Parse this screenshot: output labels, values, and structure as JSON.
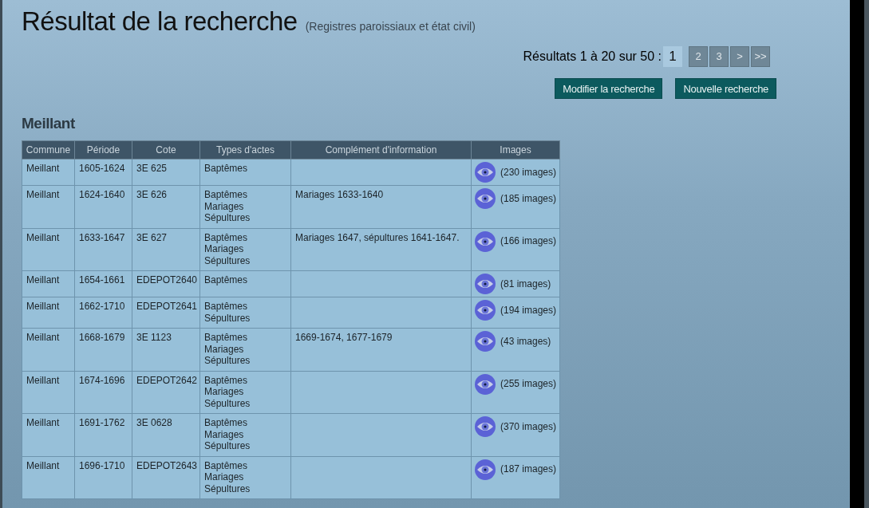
{
  "title": "Résultat de la recherche",
  "subtitle": "(Registres paroissiaux et état civil)",
  "pagination": {
    "summary": "Résultats 1 à 20 sur 50 :",
    "pages": [
      {
        "label": "1",
        "selected": true
      },
      {
        "label": "2",
        "selected": false
      },
      {
        "label": "3",
        "selected": false
      },
      {
        "label": ">",
        "selected": false
      },
      {
        "label": ">>",
        "selected": false
      }
    ]
  },
  "buttons": [
    "Modifier la recherche",
    "Nouvelle recherche"
  ],
  "section_title": "Meillant",
  "table": {
    "columns": [
      "Commune",
      "Période",
      "Cote",
      "Types d'actes",
      "Complément d'information",
      "Images"
    ],
    "rows": [
      {
        "commune": "Meillant",
        "periode": "1605-1624",
        "cote": "3E 625",
        "types": [
          "Baptêmes"
        ],
        "complement": "",
        "images": "(230 images)"
      },
      {
        "commune": "Meillant",
        "periode": "1624-1640",
        "cote": "3E 626",
        "types": [
          "Baptêmes",
          "Mariages",
          "Sépultures"
        ],
        "complement": "Mariages 1633-1640",
        "images": "(185 images)"
      },
      {
        "commune": "Meillant",
        "periode": "1633-1647",
        "cote": "3E 627",
        "types": [
          "Baptêmes",
          "Mariages",
          "Sépultures"
        ],
        "complement": "Mariages 1647, sépultures 1641-1647.",
        "images": "(166 images)"
      },
      {
        "commune": "Meillant",
        "periode": "1654-1661",
        "cote": "EDEPOT2640",
        "types": [
          "Baptêmes"
        ],
        "complement": "",
        "images": "(81 images)"
      },
      {
        "commune": "Meillant",
        "periode": "1662-1710",
        "cote": "EDEPOT2641",
        "types": [
          "Baptêmes",
          "Sépultures"
        ],
        "complement": "",
        "images": "(194 images)"
      },
      {
        "commune": "Meillant",
        "periode": "1668-1679",
        "cote": "3E 1123",
        "types": [
          "Baptêmes",
          "Mariages",
          "Sépultures"
        ],
        "complement": "1669-1674, 1677-1679",
        "images": "(43 images)"
      },
      {
        "commune": "Meillant",
        "periode": "1674-1696",
        "cote": "EDEPOT2642",
        "types": [
          "Baptêmes",
          "Mariages",
          "Sépultures"
        ],
        "complement": "",
        "images": "(255 images)"
      },
      {
        "commune": "Meillant",
        "periode": "1691-1762",
        "cote": "3E 0628",
        "types": [
          "Baptêmes",
          "Mariages",
          "Sépultures"
        ],
        "complement": "",
        "images": "(370 images)"
      },
      {
        "commune": "Meillant",
        "periode": "1696-1710",
        "cote": "EDEPOT2643",
        "types": [
          "Baptêmes",
          "Mariages",
          "Sépultures"
        ],
        "complement": "",
        "images": "(187 images)"
      }
    ]
  }
}
